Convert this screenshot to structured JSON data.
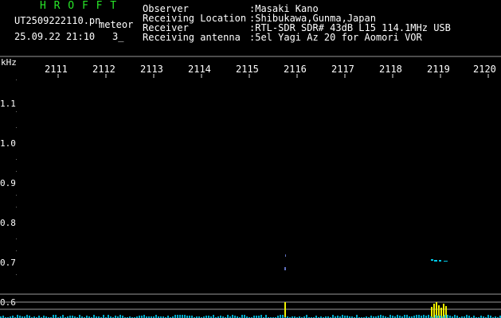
{
  "header": {
    "station": "H R O F F T",
    "filename": "UT2509222110.pn",
    "filename_suffix": "meteor",
    "datetime": "25.09.22 21:10",
    "count": "3_",
    "info_labels": [
      "Observer",
      "Receiving Location",
      "Receiver",
      "Receiving antenna"
    ],
    "info_values": [
      ":Masaki Kano",
      ":Shibukawa,Gunma,Japan",
      ":RTL-SDR SDR# 43dB L15 114.1MHz USB",
      ":5el Yagi Az 20 for Aomori VOR"
    ]
  },
  "axes": {
    "y_unit": "kHz",
    "y_ticks": [
      "1.1",
      "1.0",
      "0.9",
      "0.8",
      "0.7",
      "0.6"
    ],
    "time_ticks": [
      "2111",
      "2112",
      "2113",
      "2114",
      "2115",
      "2116",
      "2117",
      "2118",
      "2119",
      "2120"
    ]
  },
  "colors": {
    "background": "#000000",
    "label_green": "#28e628",
    "text_white": "#ffffff",
    "echo_yellow": "#f0f000",
    "noise_cyan": "#00c8e6",
    "grid": "#9a9a9a"
  }
}
